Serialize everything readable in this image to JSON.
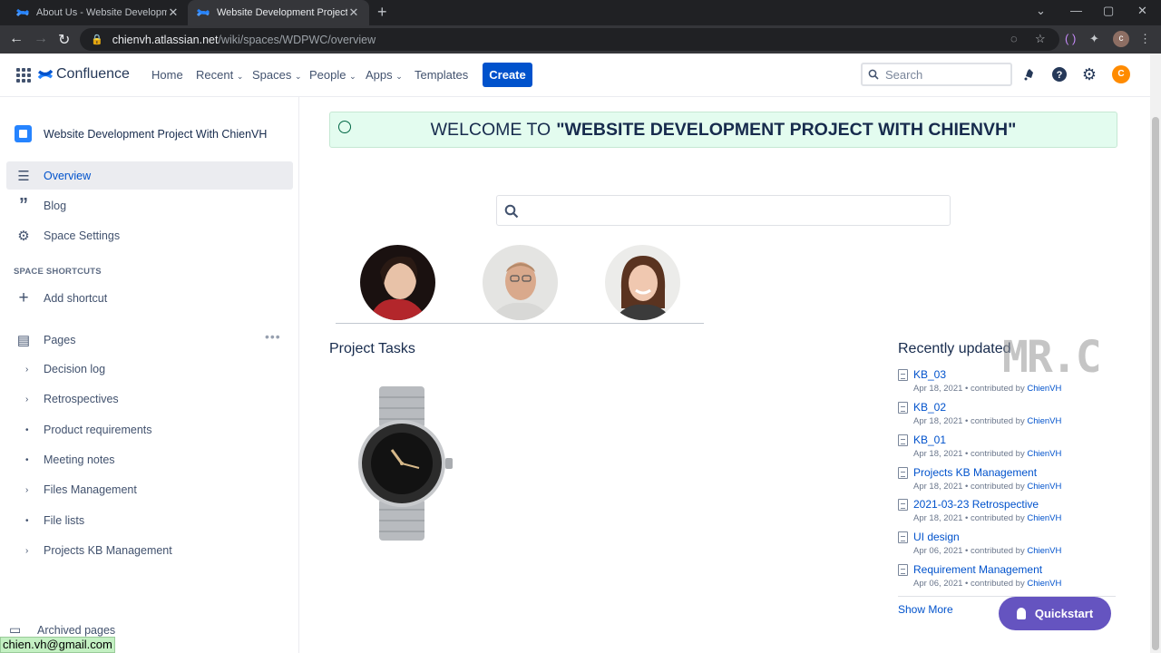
{
  "browser": {
    "tabs": [
      {
        "title": "About Us - Website Development"
      },
      {
        "title": "Website Development Project Wi"
      }
    ],
    "url_host": "chienvh.atlassian.net",
    "url_path": "/wiki/spaces/WDPWC/overview"
  },
  "header": {
    "product": "Confluence",
    "nav": [
      "Home",
      "Recent",
      "Spaces",
      "People",
      "Apps",
      "Templates"
    ],
    "create_label": "Create",
    "search_placeholder": "Search",
    "user_initial": "C"
  },
  "sidebar": {
    "space_name": "Website Development Project With ChienVH",
    "items": [
      {
        "label": "Overview",
        "icon": "overview-icon"
      },
      {
        "label": "Blog",
        "icon": "quote-icon"
      },
      {
        "label": "Space Settings",
        "icon": "gear-icon"
      }
    ],
    "shortcuts_label": "SPACE SHORTCUTS",
    "add_shortcut": "Add shortcut",
    "pages_label": "Pages",
    "pages": [
      {
        "label": "Decision log",
        "marker": "›"
      },
      {
        "label": "Retrospectives",
        "marker": "›"
      },
      {
        "label": "Product requirements",
        "marker": "•"
      },
      {
        "label": "Meeting notes",
        "marker": "•"
      },
      {
        "label": "Files Management",
        "marker": "›"
      },
      {
        "label": "File lists",
        "marker": "•"
      },
      {
        "label": "Projects KB Management",
        "marker": "›"
      }
    ],
    "archived": "Archived pages",
    "status_email": "chien.vh@gmail.com"
  },
  "main": {
    "welcome_prefix": "WELCOME TO",
    "welcome_name": "\"WEBSITE DEVELOPMENT PROJECT WITH CHIENVH\"",
    "project_tasks": "Project Tasks",
    "recent_title": "Recently updated",
    "watermark": "MR.C",
    "recent": [
      {
        "title": "KB_03",
        "date": "Apr 18, 2021",
        "by": "ChienVH"
      },
      {
        "title": "KB_02",
        "date": "Apr 18, 2021",
        "by": "ChienVH"
      },
      {
        "title": "KB_01",
        "date": "Apr 18, 2021",
        "by": "ChienVH"
      },
      {
        "title": "Projects KB Management",
        "date": "Apr 18, 2021",
        "by": "ChienVH"
      },
      {
        "title": "2021-03-23 Retrospective",
        "date": "Apr 18, 2021",
        "by": "ChienVH"
      },
      {
        "title": "UI design",
        "date": "Apr 06, 2021",
        "by": "ChienVH"
      },
      {
        "title": "Requirement Management",
        "date": "Apr 06, 2021",
        "by": "ChienVH"
      }
    ],
    "contributed_text": "• contributed by",
    "show_more": "Show More",
    "quickstart": "Quickstart"
  },
  "colors": {
    "brand_blue": "#0052cc",
    "welcome_bg": "#e3fcef",
    "quickstart_bg": "#6554c0"
  }
}
